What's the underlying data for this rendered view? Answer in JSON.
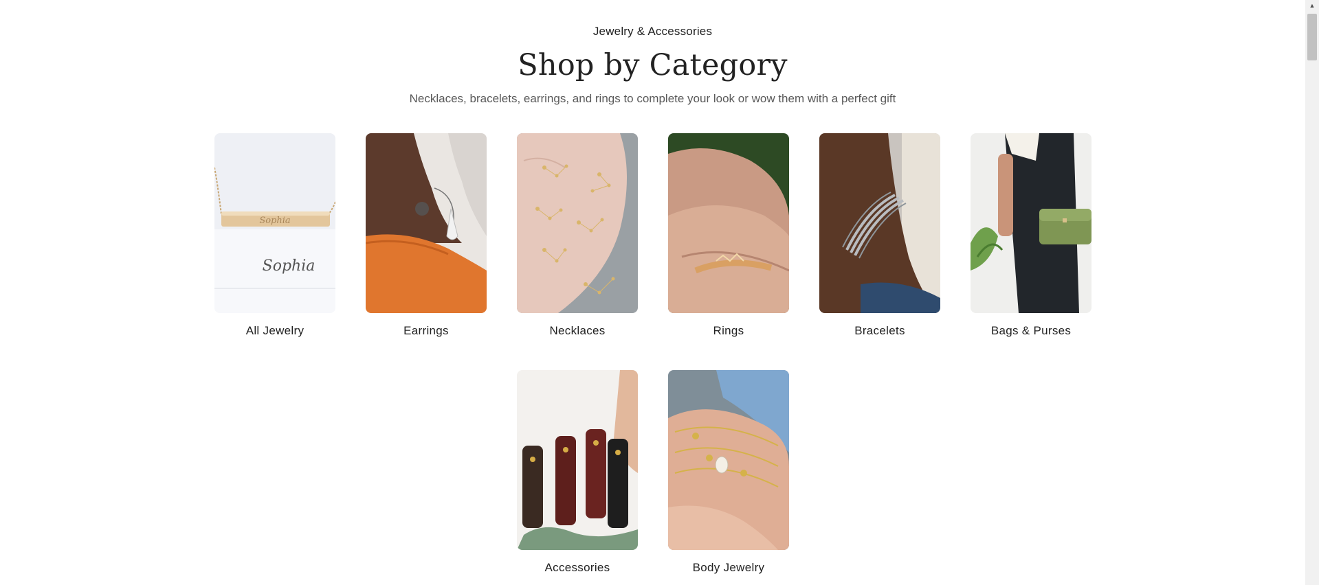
{
  "header": {
    "eyebrow": "Jewelry & Accessories",
    "title": "Shop by Category",
    "subtitle": "Necklaces, bracelets, earrings, and rings to complete your look or wow them with a perfect gift"
  },
  "categories": [
    {
      "label": "All Jewelry"
    },
    {
      "label": "Earrings"
    },
    {
      "label": "Necklaces"
    },
    {
      "label": "Rings"
    },
    {
      "label": "Bracelets"
    },
    {
      "label": "Bags & Purses"
    },
    {
      "label": "Accessories"
    },
    {
      "label": "Body Jewelry"
    }
  ],
  "scrollbar": {
    "up_arrow_icon": "triangle-up"
  }
}
